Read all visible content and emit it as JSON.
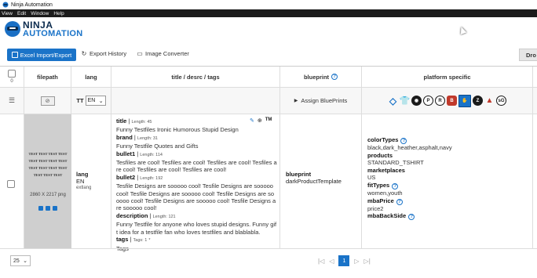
{
  "window": {
    "title": "Ninja Automation"
  },
  "menu": [
    "View",
    "Edit",
    "Window",
    "Help"
  ],
  "logo": {
    "line1": "NINJA",
    "line2": "AUTOMATION"
  },
  "toolbar": {
    "excel": "Excel Import/Export",
    "history": "Export History",
    "image": "Image Converter",
    "drop": "Dro"
  },
  "headers": {
    "count": "0",
    "filepath": "filepath",
    "lang": "lang",
    "title": "title / desrc / tags",
    "blueprint": "blueprint",
    "platform": "platform specific"
  },
  "filter": {
    "lang_label": "TT",
    "lang_value": "EN",
    "assign": "Assign BluePrints",
    "platform_icons": [
      "diamond-icon",
      "shirt-icon",
      "circle-icon",
      "p-icon",
      "r-icon",
      "b-icon",
      "z-icon",
      "z2-icon",
      "tri-icon",
      "sg-icon"
    ]
  },
  "row": {
    "thumb_text": "TEST TEST TEST TEST TEST TEST TEST TEST TEST TEST TEST TEST TEST TEST TEST",
    "dims": "2860 X 2217 png",
    "lang_label": "lang",
    "lang_value": "EN",
    "lang_sub": "extlang",
    "tm": "TM",
    "title_label": "title",
    "title_len": "Length: 45",
    "title_val": "Funny Testfiles Ironic Humorous Stupid Design",
    "brand_label": "brand",
    "brand_len": "Length: 31",
    "brand_val": "Funny Testfile Quotes and Gifts",
    "b1_label": "bullet1",
    "b1_len": "Length: 114",
    "b1_val": "Tesfiles are cool! Tesfiles are cool! Tesfiles are cool! Tesfiles are cool! Tesfiles are cool! Tesfiles are cool!",
    "b2_label": "bullet2",
    "b2_len": "Length: 192",
    "b2_val": "Tesfile Designs are sooooo cool! Tesfile Designs are sooooo cool! Tesfile Designs are sooooo cool! Tesfile Designs are sooooo cool! Tesfile Designs are sooooo cool! Tesfile Designs are sooooo cool!",
    "desc_label": "description",
    "desc_len": "Length: 121",
    "desc_val": "Funny Testfile for anyone who loves stupid designs. Funny gift idea for a testfile fan who loves testfiles and blablabla.",
    "tags_label": "tags",
    "tags_len": "Tags: 1",
    "tags_star": "*",
    "tags_val": "Tags",
    "bp_label": "blueprint",
    "bp_val": "darkProductTemplate",
    "pf_colortypes": "colorTypes",
    "pf_colortypes_val": "black,dark_heather,asphalt,navy",
    "pf_products": "products",
    "pf_products_val": "STANDARD_TSHIRT",
    "pf_marketplaces": "marketplaces",
    "pf_marketplaces_val": "US",
    "pf_fittypes": "fitTypes",
    "pf_fittypes_val": "women,youth",
    "pf_mbaprice": "mbaPrice",
    "pf_mbaprice_val": "price2",
    "pf_mbabackside": "mbaBackSide"
  },
  "footer": {
    "page_size": "25",
    "current_page": "1"
  }
}
